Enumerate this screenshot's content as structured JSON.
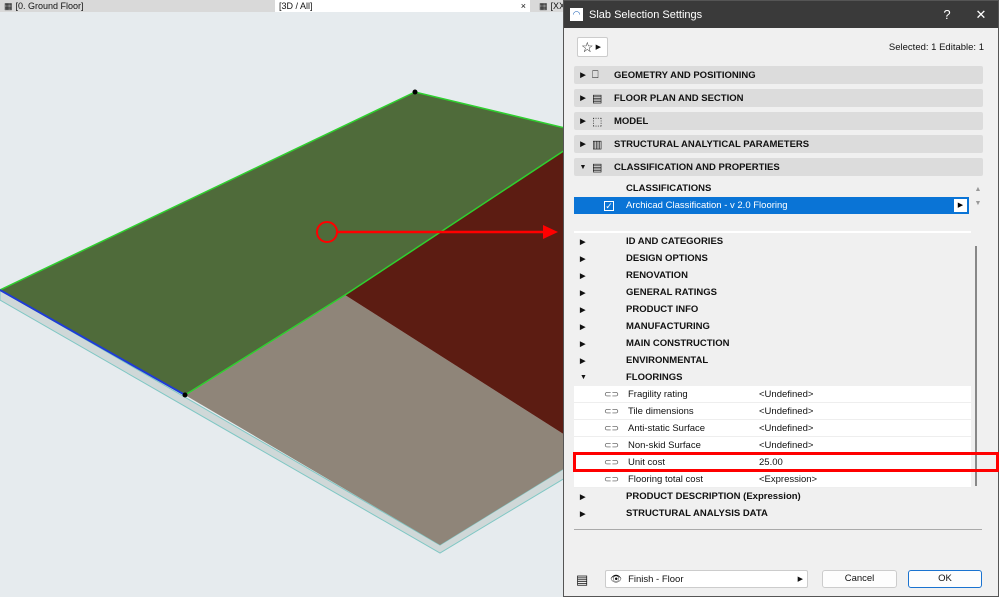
{
  "tabs": [
    {
      "label": "[0. Ground Floor]"
    },
    {
      "label": "[3D / All]",
      "close": "×"
    },
    {
      "label": "[XX"
    }
  ],
  "dialog": {
    "title": "Slab Selection Settings",
    "help": "?",
    "close": "✕",
    "selection_info": "Selected: 1 Editable: 1",
    "sections": [
      {
        "label": "GEOMETRY AND POSITIONING",
        "icon": "geometry-icon"
      },
      {
        "label": "FLOOR PLAN AND SECTION",
        "icon": "floor-plan-icon"
      },
      {
        "label": "MODEL",
        "icon": "model-icon"
      },
      {
        "label": "STRUCTURAL ANALYTICAL PARAMETERS",
        "icon": "structural-icon"
      },
      {
        "label": "CLASSIFICATION AND PROPERTIES",
        "icon": "properties-icon",
        "expanded": true
      }
    ],
    "classifications_header": "CLASSIFICATIONS",
    "classification": "Archicad Classification - v 2.0 Flooring",
    "groups": [
      "ID AND CATEGORIES",
      "DESIGN OPTIONS",
      "RENOVATION",
      "GENERAL RATINGS",
      "PRODUCT INFO",
      "MANUFACTURING",
      "MAIN CONSTRUCTION",
      "ENVIRONMENTAL",
      "FLOORINGS"
    ],
    "properties": [
      {
        "name": "Fragility rating",
        "value": "<Undefined>"
      },
      {
        "name": "Tile dimensions",
        "value": "<Undefined>"
      },
      {
        "name": "Anti-static Surface",
        "value": "<Undefined>"
      },
      {
        "name": "Non-skid Surface",
        "value": "<Undefined>"
      },
      {
        "name": "Unit cost",
        "value": "25.00"
      },
      {
        "name": "Flooring total cost",
        "value": "<Expression>"
      }
    ],
    "groups_after": [
      "PRODUCT DESCRIPTION (Expression)",
      "STRUCTURAL ANALYSIS DATA"
    ],
    "layer": "Finish - Floor",
    "cancel": "Cancel",
    "ok": "OK"
  },
  "colors": {
    "highlight": "#ff0000",
    "selection": "#0a74d6",
    "slab_green": "#4f6b3a",
    "slab_brown": "#5c1c12",
    "slab_gray": "#8f8579"
  }
}
